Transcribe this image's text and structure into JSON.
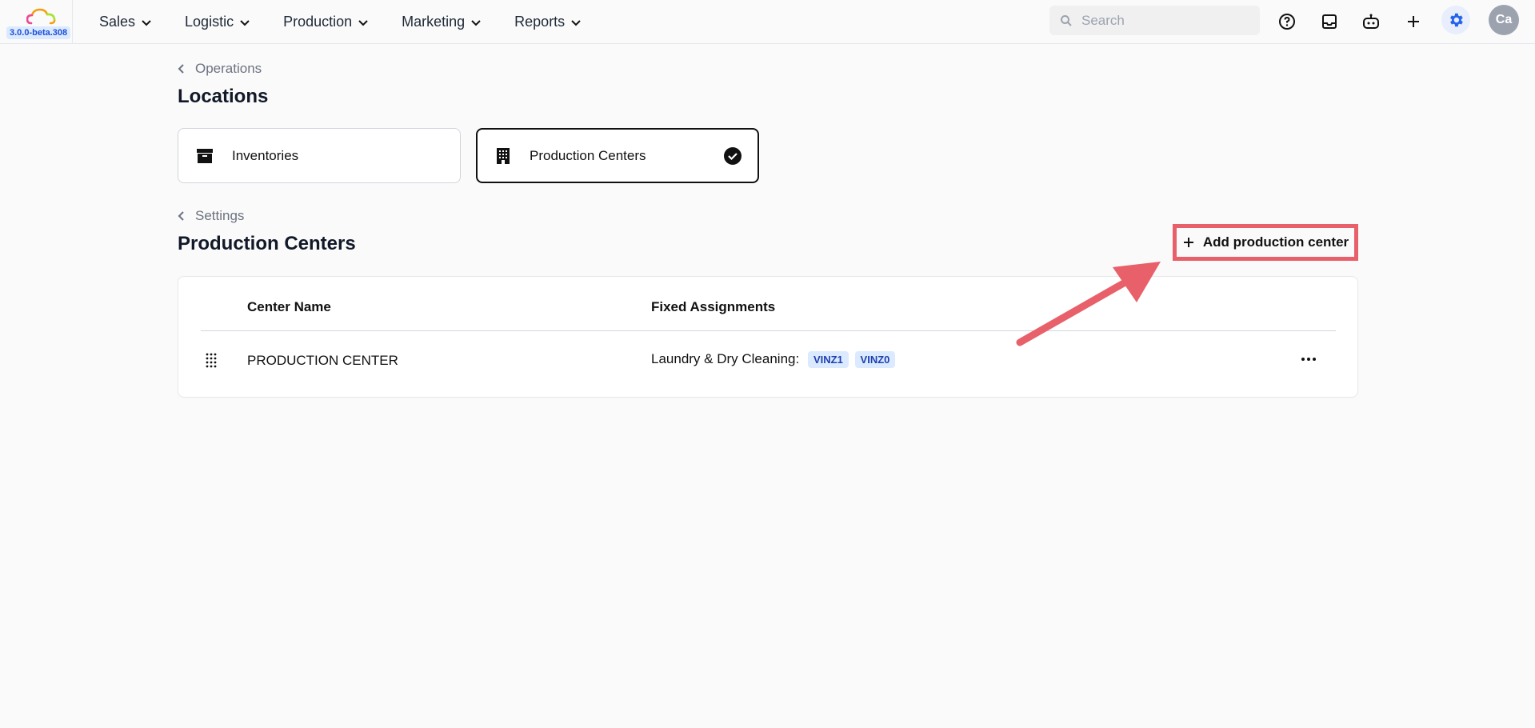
{
  "header": {
    "version": "3.0.0-beta.308",
    "nav": [
      {
        "label": "Sales"
      },
      {
        "label": "Logistic"
      },
      {
        "label": "Production"
      },
      {
        "label": "Marketing"
      },
      {
        "label": "Reports"
      }
    ],
    "search_placeholder": "Search",
    "avatar_initials": "Ca",
    "accent_color": "#2563eb"
  },
  "breadcrumb_top": "Operations",
  "page_title": "Locations",
  "location_cards": [
    {
      "label": "Inventories",
      "icon": "archive-box-icon",
      "selected": false
    },
    {
      "label": "Production Centers",
      "icon": "building-icon",
      "selected": true
    }
  ],
  "breadcrumb_section": "Settings",
  "section_title": "Production Centers",
  "add_button_label": "Add production center",
  "table": {
    "columns": [
      "Center Name",
      "Fixed Assignments"
    ],
    "rows": [
      {
        "name": "PRODUCTION CENTER",
        "assignment_label": "Laundry & Dry Cleaning:",
        "tags": [
          "VINZ1",
          "VINZ0"
        ]
      }
    ]
  },
  "annotation_color": "#e8606a"
}
